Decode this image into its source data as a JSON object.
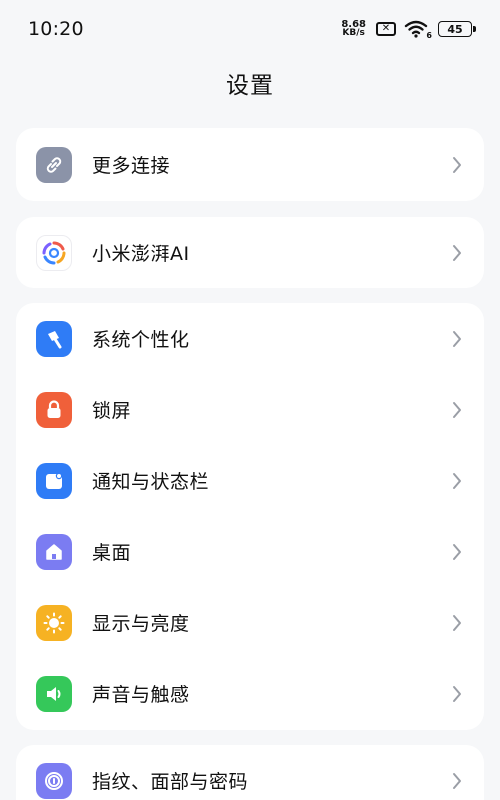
{
  "status_bar": {
    "time": "10:20",
    "net_speed_value": "8.68",
    "net_speed_unit": "KB/s",
    "wifi_badge": "6",
    "battery": "45"
  },
  "header": {
    "title": "设置"
  },
  "sections": [
    {
      "items": [
        {
          "label": "更多连接",
          "icon": "link-icon",
          "color": "#8b93a8"
        }
      ]
    },
    {
      "items": [
        {
          "label": "小米澎湃AI",
          "icon": "ai-swirl-icon",
          "color": "#ffffff"
        }
      ]
    },
    {
      "items": [
        {
          "label": "系统个性化",
          "icon": "brush-icon",
          "color": "#2f7cf6"
        },
        {
          "label": "锁屏",
          "icon": "lock-icon",
          "color": "#f0603a"
        },
        {
          "label": "通知与状态栏",
          "icon": "notification-icon",
          "color": "#2f7cf6"
        },
        {
          "label": "桌面",
          "icon": "home-icon",
          "color": "#7b7cf2"
        },
        {
          "label": "显示与亮度",
          "icon": "sun-icon",
          "color": "#f6b223"
        },
        {
          "label": "声音与触感",
          "icon": "speaker-icon",
          "color": "#35c85a"
        }
      ]
    },
    {
      "items": [
        {
          "label": "指纹、面部与密码",
          "icon": "fingerprint-icon",
          "color": "#7b7cf2"
        }
      ]
    }
  ]
}
